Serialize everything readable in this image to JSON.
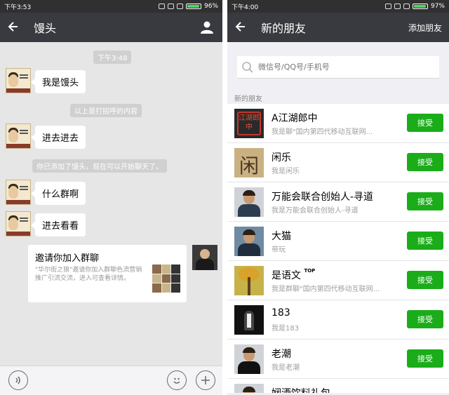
{
  "left": {
    "status": {
      "time": "下午3:53",
      "battery": "96%",
      "battery_level": 0.96
    },
    "header": {
      "title": "馒头"
    },
    "messages": {
      "timestamp": "下午3:48",
      "m1": "我是馒头",
      "sys1": "以上是打招呼的内容",
      "m2": "进去进去",
      "sys2": "你已添加了馒头，现在可以开始聊天了。",
      "m3": "什么群啊",
      "m4": "进去看看"
    },
    "invite": {
      "title": "邀请你加入群聊",
      "desc": "\"华尔街之狼\"邀请你加入群聊色流营销推广引流交流，进入可查看详情。"
    }
  },
  "right": {
    "status": {
      "time": "下午4:00",
      "battery": "97%",
      "battery_level": 0.97
    },
    "header": {
      "title": "新的朋友",
      "action": "添加朋友"
    },
    "search": {
      "placeholder": "微信号/QQ号/手机号"
    },
    "section_label": "新的朋友",
    "accept_label": "接受",
    "friends": [
      {
        "name": "A江湖郎中",
        "sub": "我是聊\"国内第四代移动互联网...",
        "avatar_text": "江湖郎中"
      },
      {
        "name": "闲乐",
        "sub": "我是闲乐",
        "avatar_text": "闲"
      },
      {
        "name": "万能会联合创始人-寻道",
        "sub": "我是万能会联合创始人-寻道"
      },
      {
        "name": "大猫",
        "sub": "带玩"
      },
      {
        "name": "是语文",
        "sub": "我是群聊\"国内第四代移动互联网...",
        "badge": "TOP"
      },
      {
        "name": "183",
        "sub": "我是183"
      },
      {
        "name": "老潮",
        "sub": "我是老潮"
      },
      {
        "name": "娴酒饮料礼包"
      }
    ]
  }
}
